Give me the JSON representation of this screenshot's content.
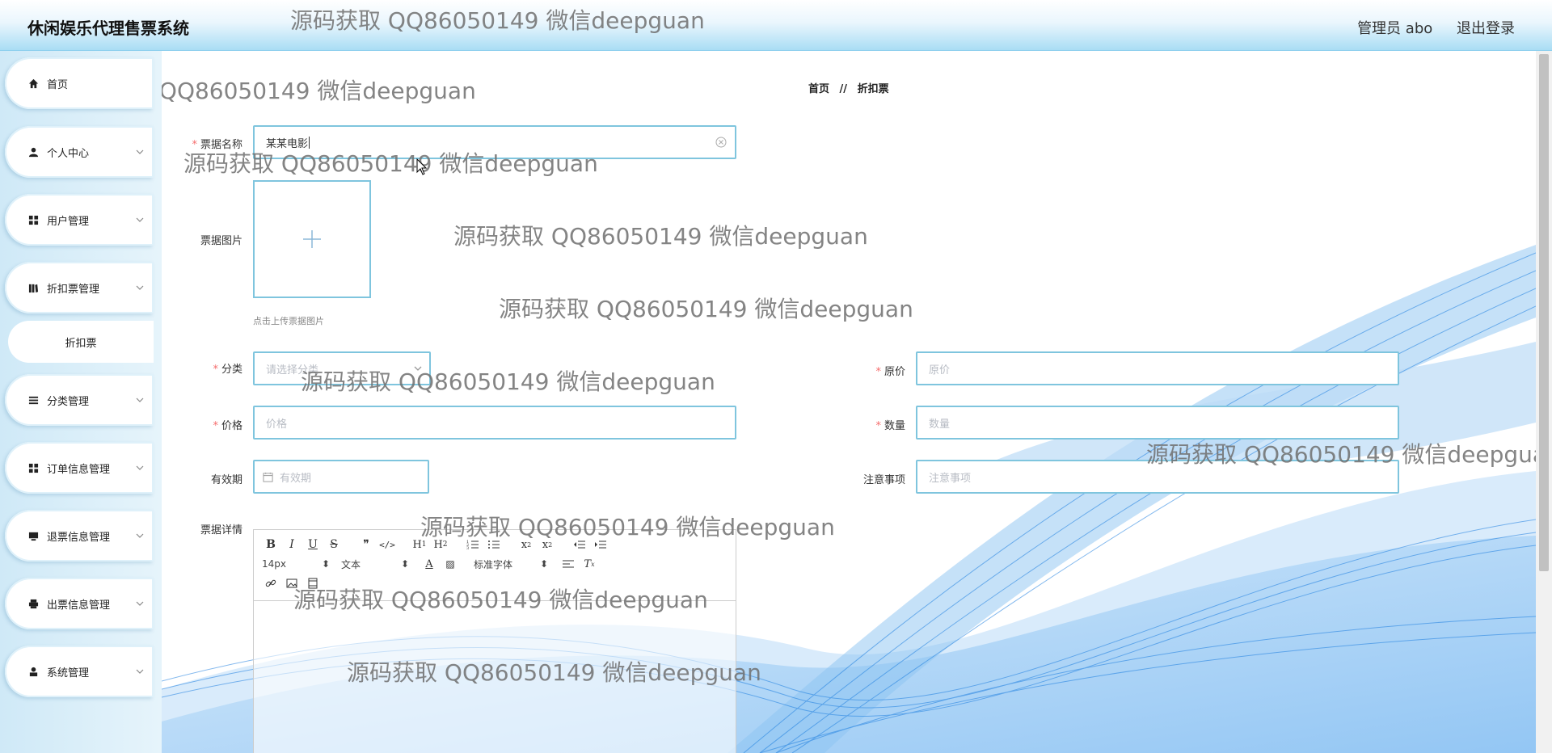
{
  "header": {
    "title": "休闲娱乐代理售票系统",
    "user": "管理员 abo",
    "logout": "退出登录"
  },
  "sidebar": {
    "items": [
      {
        "label": "首页",
        "icon": "home-icon"
      },
      {
        "label": "个人中心",
        "icon": "user-icon"
      },
      {
        "label": "用户管理",
        "icon": "grid-icon"
      },
      {
        "label": "折扣票管理",
        "icon": "book-icon"
      },
      {
        "label": "分类管理",
        "icon": "list-icon"
      },
      {
        "label": "订单信息管理",
        "icon": "grid-icon"
      },
      {
        "label": "退票信息管理",
        "icon": "monitor-icon"
      },
      {
        "label": "出票信息管理",
        "icon": "printer-icon"
      },
      {
        "label": "系统管理",
        "icon": "person-icon"
      }
    ],
    "subitem": "折扣票"
  },
  "breadcrumb": {
    "home": "首页",
    "sep": "//",
    "current": "折扣票"
  },
  "form": {
    "name": {
      "label": "票据名称",
      "value": "某某电影"
    },
    "image": {
      "label": "票据图片",
      "tip": "点击上传票据图片"
    },
    "category": {
      "label": "分类",
      "placeholder": "请选择分类"
    },
    "original_price": {
      "label": "原价",
      "placeholder": "原价"
    },
    "price": {
      "label": "价格",
      "placeholder": "价格"
    },
    "quantity": {
      "label": "数量",
      "placeholder": "数量"
    },
    "validity": {
      "label": "有效期",
      "placeholder": "有效期"
    },
    "notes": {
      "label": "注意事项",
      "placeholder": "注意事项"
    },
    "details": {
      "label": "票据详情"
    }
  },
  "editor": {
    "font_size": "14px",
    "block_type": "文本",
    "font_family": "标准字体",
    "buttons_row1": [
      "B",
      "I",
      "U",
      "S",
      "❞",
      "</>",
      "H1",
      "H2",
      "ol",
      "ul",
      "x₂",
      "x²",
      "outdent",
      "indent"
    ]
  },
  "watermark": "源码获取 QQ86050149 微信deepguan",
  "colors": {
    "accent": "#7fc5de",
    "required": "#f56c6c",
    "header_bottom": "#a9ddf4",
    "wave_blue": "#1e7fe0"
  }
}
